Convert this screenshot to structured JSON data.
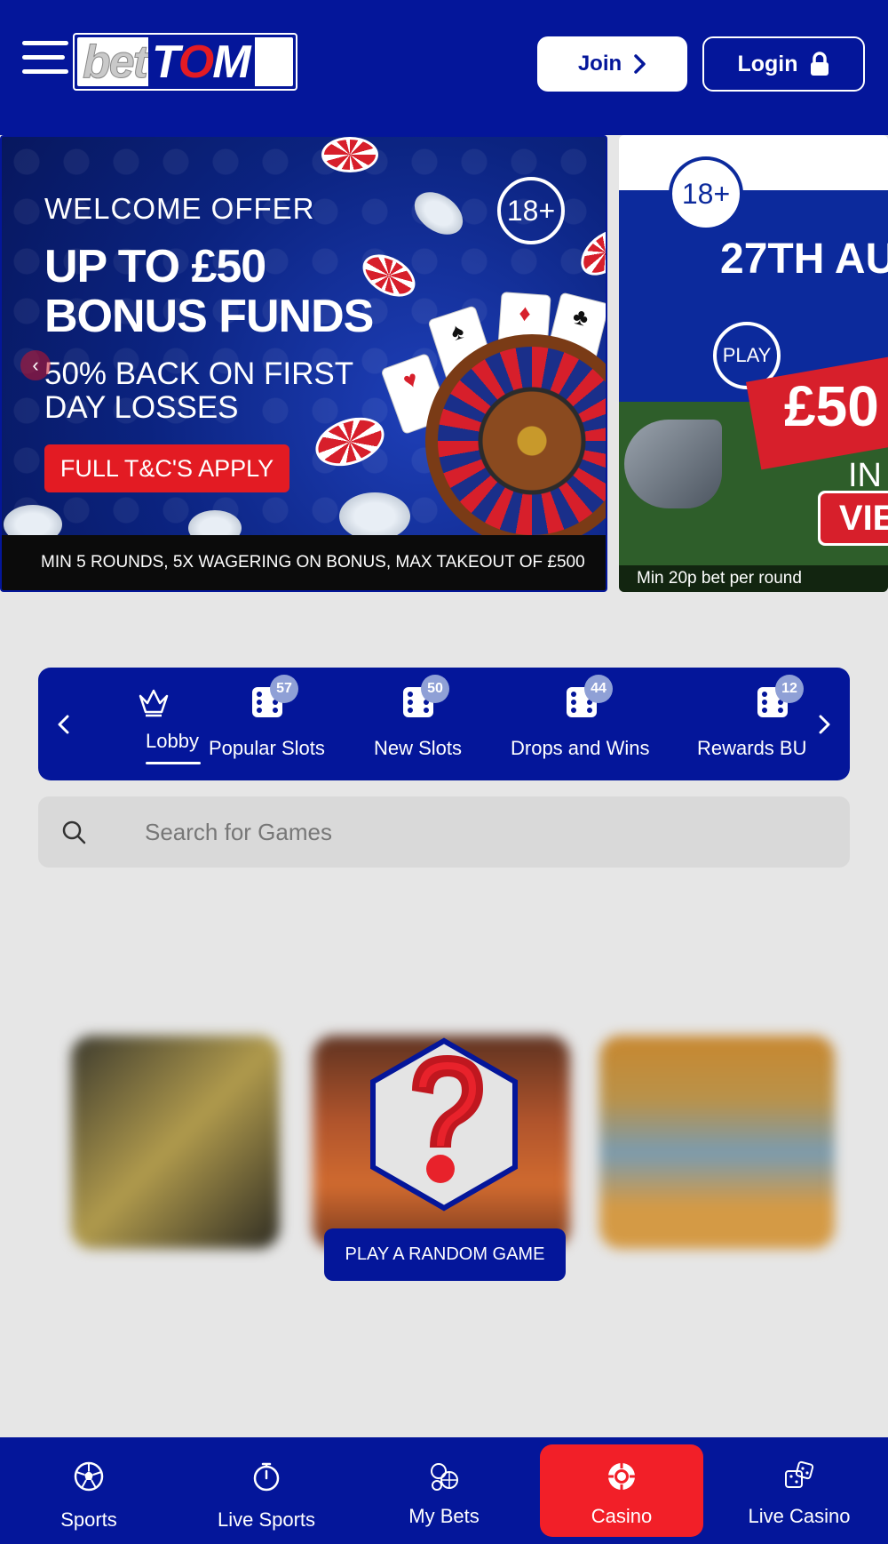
{
  "header": {
    "logo_text_bet": "bet",
    "logo_text_t": "T",
    "logo_text_o": "O",
    "logo_text_m": "M",
    "join_label": "Join",
    "login_label": "Login"
  },
  "promo": {
    "banner1": {
      "age": "18+",
      "welcome": "WELCOME OFFER",
      "headline": "UP TO £50 BONUS FUNDS",
      "sub": "50% BACK ON FIRST DAY LOSSES",
      "tc_button": "FULL T&C'S APPLY",
      "footer": "MIN 5 ROUNDS, 5X WAGERING ON BONUS, MAX TAKEOUT OF £500"
    },
    "banner2": {
      "age": "18+",
      "date": "27TH AU",
      "play": "PLAY",
      "amount": "£50",
      "in": "IN",
      "view": "VIEW",
      "footer": "Min 20p bet per round"
    }
  },
  "categories": [
    {
      "label": "Lobby",
      "icon": "crown-icon",
      "active": true
    },
    {
      "label": "Popular Slots",
      "icon": "dice-icon",
      "count": "57"
    },
    {
      "label": "New Slots",
      "icon": "dice-icon",
      "count": "50"
    },
    {
      "label": "Drops and Wins",
      "icon": "dice-icon",
      "count": "44"
    },
    {
      "label": "Rewards BU",
      "icon": "dice-icon",
      "count": "12"
    }
  ],
  "search": {
    "placeholder": "Search for Games"
  },
  "random_game": {
    "button_label": "PLAY A RANDOM GAME"
  },
  "bottom_nav": [
    {
      "label": "Sports",
      "icon": "football-icon"
    },
    {
      "label": "Live Sports",
      "icon": "stopwatch-icon"
    },
    {
      "label": "My Bets",
      "icon": "balls-icon"
    },
    {
      "label": "Casino",
      "icon": "casino-chip-icon",
      "active": true
    },
    {
      "label": "Live Casino",
      "icon": "dice-pair-icon"
    }
  ],
  "colors": {
    "brand_blue": "#04169a",
    "accent_red": "#f21f28",
    "page_bg": "#e6e6e6"
  }
}
